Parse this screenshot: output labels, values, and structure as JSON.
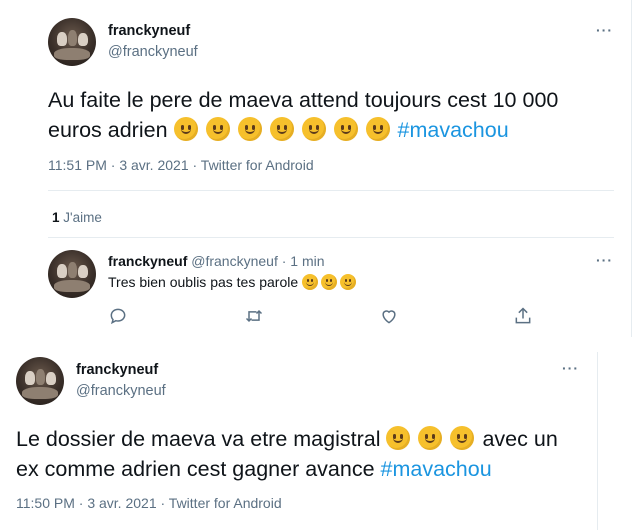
{
  "tweet1": {
    "name": "franckyneuf",
    "handle": "@franckyneuf",
    "text": "Au faite le pere de maeva attend toujours cest 10 000 euros adrien",
    "emoji_count": 7,
    "hashtag": "#mavachou",
    "timestamp": "11:51 PM · 3 avr. 2021 · Twitter for Android",
    "likes_count": "1",
    "likes_label": "J'aime"
  },
  "reply": {
    "name": "franckyneuf",
    "handle_time": "@franckyneuf · 1 min",
    "text": "Tres bien oublis pas tes parole",
    "emoji_count": 3
  },
  "tweet2": {
    "name": "franckyneuf",
    "handle": "@franckyneuf",
    "text_before": "Le dossier de maeva va etre magistral",
    "emoji_count": 3,
    "text_after": "avec un ex comme adrien cest gagner avance",
    "hashtag": "#mavachou",
    "timestamp": "11:50 PM · 3 avr. 2021 · Twitter for Android"
  },
  "icons": {
    "reply": "reply-icon",
    "retweet": "retweet-icon",
    "like": "heart-icon",
    "share": "share-icon",
    "more": "more-icon"
  },
  "colors": {
    "hashtag": "#1b95e0",
    "secondary_text": "#5b7083",
    "divider": "#e6ecf0"
  },
  "more_label": "···"
}
